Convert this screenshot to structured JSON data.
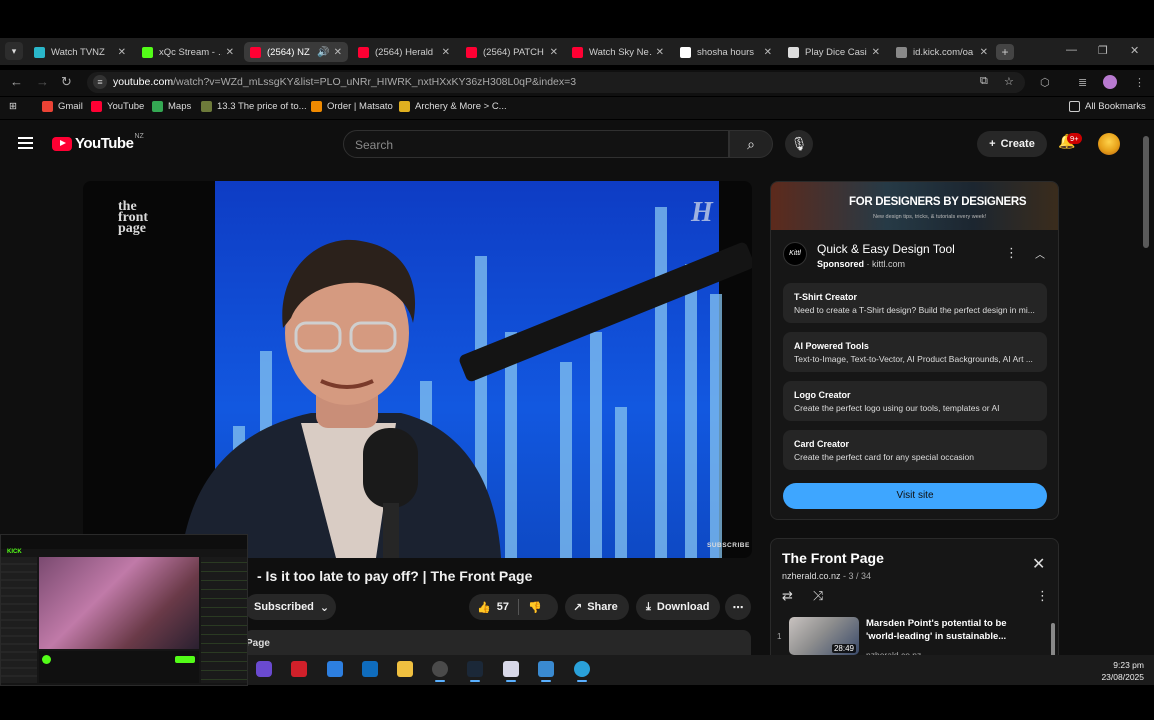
{
  "browser": {
    "tabs": [
      {
        "title": "Watch TVNZ",
        "fav": "#2ab7ca"
      },
      {
        "title": "xQc Stream - …",
        "fav": "#53fc18"
      },
      {
        "title": "(2564) NZ",
        "fav": "#ff0033",
        "active": true
      },
      {
        "title": "(2564) Herald",
        "fav": "#ff0033"
      },
      {
        "title": "(2564) PATCH",
        "fav": "#ff0033"
      },
      {
        "title": "Watch Sky Ne…",
        "fav": "#ff0033"
      },
      {
        "title": "shosha hours",
        "fav": "#ffffff"
      },
      {
        "title": "Play Dice Casi…",
        "fav": "#dddddd"
      },
      {
        "title": "id.kick.com/oa",
        "fav": "#888888"
      }
    ],
    "url_host": "youtube.com",
    "url_path": "/watch?v=WZd_mLssgKY&list=PLO_uNRr_HIWRK_nxtHXxKY36zH308L0qP&index=3",
    "bookmarks": [
      {
        "label": "Gmail",
        "color": "#ea4335"
      },
      {
        "label": "YouTube",
        "color": "#ff0033"
      },
      {
        "label": "Maps",
        "color": "#34a853"
      },
      {
        "label": "13.3 The price of to...",
        "color": "#6d7a3a"
      },
      {
        "label": "Order | Matsato",
        "color": "#f08a00"
      },
      {
        "label": "Archery & More > C...",
        "color": "#e0b020"
      }
    ],
    "all_bookmarks": "All Bookmarks"
  },
  "youtube": {
    "logo_text": "YouTube",
    "country": "NZ",
    "search_placeholder": "Search",
    "create_label": "Create",
    "notif_badge": "9+",
    "video": {
      "title": "- Is it too late to pay off? | The Front Page",
      "subscribed_label": "Subscribed",
      "likes": "57",
      "share_label": "Share",
      "download_label": "Download",
      "desc_prefix": "Page",
      "wm_logo": "the front page",
      "wm_subscribe": "SUBSCRIBE",
      "wm_h": "H"
    },
    "ad": {
      "banner_title": "FOR DESIGNERS BY DESIGNERS",
      "banner_sub": "New design tips, tricks, & tutorials every week!",
      "logo": "Kittl",
      "title": "Quick & Easy Design Tool",
      "sponsored": "Sponsored",
      "domain": "kittl.com",
      "cards": [
        {
          "head": "T-Shirt Creator",
          "desc": "Need to create a T-Shirt design? Build the perfect design in mi..."
        },
        {
          "head": "AI Powered Tools",
          "desc": "Text-to-Image, Text-to-Vector, AI Product Backgrounds, AI Art ..."
        },
        {
          "head": "Logo Creator",
          "desc": "Create the perfect logo using our tools, templates or AI"
        },
        {
          "head": "Card Creator",
          "desc": "Create the perfect card for any special occasion"
        }
      ],
      "visit_label": "Visit site"
    },
    "playlist": {
      "title": "The Front Page",
      "channel": "nzherald.co.nz",
      "position": "3 / 34",
      "item": {
        "index": "1",
        "title": "Marsden Point's potential to be 'world-leading' in sustainable...",
        "duration": "28:49",
        "channel": "nzherald.co.nz"
      }
    }
  },
  "taskbar": {
    "time": "9:23 pm",
    "date": "23/08/2025",
    "apps": [
      "start",
      "app-purple",
      "app-red",
      "store",
      "outlook",
      "explorer",
      "link",
      "steam",
      "notepad",
      "app-blue",
      "telegram"
    ]
  },
  "overlay": {
    "kick_label": "KICK"
  }
}
